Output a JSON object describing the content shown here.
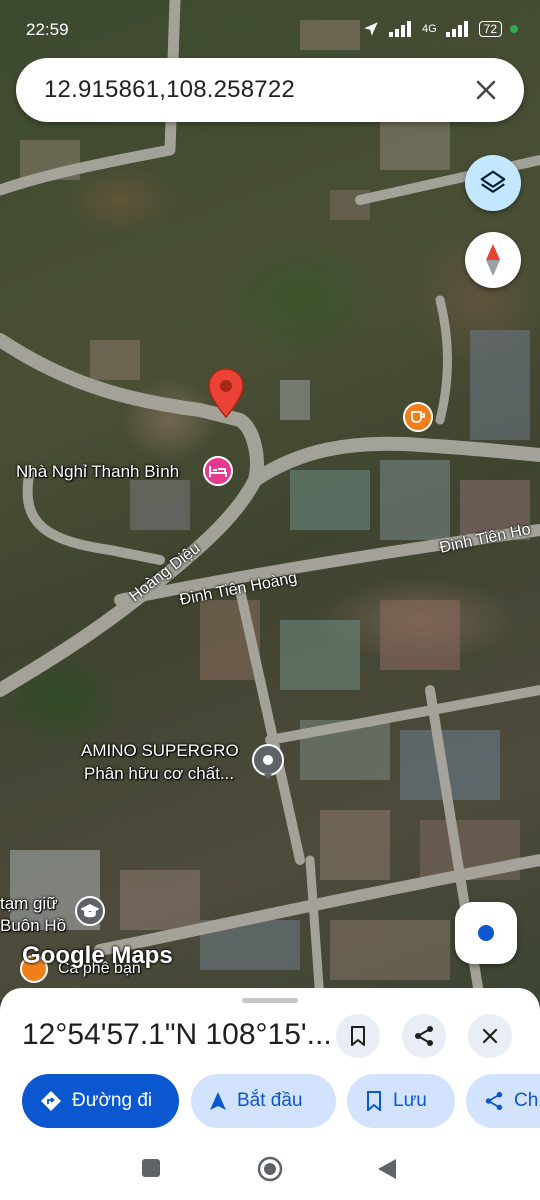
{
  "status_bar": {
    "time": "22:59",
    "network": "4G",
    "battery": "72"
  },
  "search": {
    "query": "12.915861,108.258722"
  },
  "map": {
    "places": {
      "guesthouse": "Nhà Nghỉ Thanh Bình",
      "amino_line1": "AMINO SUPERGRO",
      "amino_line2": "Phân hữu cơ chất...",
      "school_line1": "tạm giữ",
      "school_line2": "Buôn Hồ",
      "cafe": "Cà phê bạn"
    },
    "roads": {
      "hoang_dieu": "Hoàng Diệu",
      "dinh_tien_hoang_1": "Đinh Tiên Hoàng",
      "dinh_tien_hoang_2": "Đinh Tiên Ho"
    },
    "watermark": "Google Maps",
    "icons": [
      "layers-icon",
      "compass-icon",
      "my-location-icon",
      "map-pin-icon"
    ]
  },
  "sheet": {
    "title": "12°54'57.1\"N 108°15'...",
    "actions": {
      "directions": "Đường đi",
      "start": "Bắt đầu",
      "save": "Lưu",
      "share": "Ch"
    }
  },
  "colors": {
    "pin": "#ea4335",
    "primary": "#0b57d0",
    "chip": "#d3e3fd",
    "hotel": "#e8388f",
    "cafe": "#f07f1b"
  }
}
